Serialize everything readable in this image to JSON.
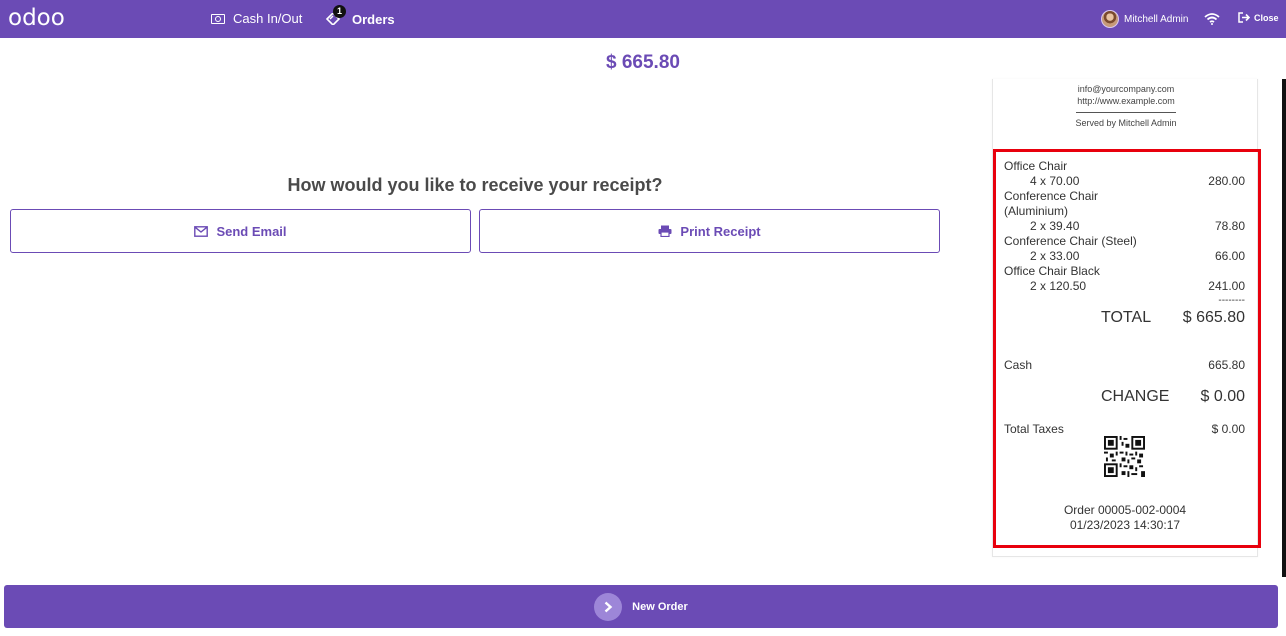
{
  "topbar": {
    "logo": "odoo",
    "cash_label": "Cash In/Out",
    "orders_label": "Orders",
    "orders_badge": "1",
    "user_name": "Mitchell Admin",
    "close_label": "Close"
  },
  "summary": {
    "amount": "$ 665.80"
  },
  "receipt_prompt": {
    "question": "How would you like to receive your receipt?",
    "email_label": "Send Email",
    "print_label": "Print Receipt"
  },
  "receipt": {
    "header": {
      "email": "info@yourcompany.com",
      "website": "http://www.example.com",
      "served_by": "Served by Mitchell Admin"
    },
    "lines": [
      {
        "name": "Office Chair",
        "qty_price": "4 x 70.00",
        "total": "280.00"
      },
      {
        "name": "Conference Chair",
        "name2": "(Aluminium)",
        "qty_price": "2 x 39.40",
        "total": "78.80"
      },
      {
        "name": "Conference Chair (Steel)",
        "qty_price": "2 x 33.00",
        "total": "66.00"
      },
      {
        "name": "Office Chair Black",
        "qty_price": "2 x 120.50",
        "total": "241.00"
      }
    ],
    "separator": "--------",
    "total_label": "TOTAL",
    "total_value": "$ 665.80",
    "payment_method": "Cash",
    "payment_amount": "665.80",
    "change_label": "CHANGE",
    "change_value": "$ 0.00",
    "taxes_label": "Total Taxes",
    "taxes_value": "$ 0.00",
    "order_ref": "Order 00005-002-0004",
    "order_datetime": "01/23/2023 14:30:17"
  },
  "footer": {
    "new_order_label": "New Order"
  },
  "colors": {
    "brand": "#6b4bb5",
    "highlight": "#e8000d"
  }
}
